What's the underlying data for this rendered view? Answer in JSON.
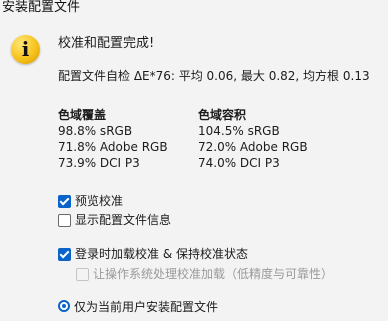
{
  "window": {
    "title": "安装配置文件"
  },
  "message": {
    "icon": "info-icon",
    "icon_glyph": "i",
    "headline": "校准和配置完成!",
    "selftest": "配置文件自检 ΔE*76: 平均 0.06, 最大 0.82, 均方根 0.13"
  },
  "coverage": {
    "heading": "色域覆盖",
    "rows": [
      "98.8% sRGB",
      "71.8% Adobe RGB",
      "73.9% DCI P3"
    ]
  },
  "volume": {
    "heading": "色域容积",
    "rows": [
      "104.5% sRGB",
      "72.0% Adobe RGB",
      "74.0% DCI P3"
    ]
  },
  "options": {
    "preview_calibration": {
      "label": "预览校准",
      "checked": true
    },
    "show_profile_info": {
      "label": "显示配置文件信息",
      "checked": false
    },
    "load_on_login": {
      "label": "登录时加载校准 & 保持校准状态",
      "checked": true
    },
    "os_load": {
      "label": "让操作系统处理校准加载（低精度与可靠性）",
      "checked": false,
      "enabled": false
    },
    "install_scope": {
      "label": "仅为当前用户安装配置文件",
      "selected": true
    }
  },
  "colors": {
    "accent": "#0a63c9",
    "background": "#f3f3f3",
    "info_icon": "#f6c21a",
    "disabled_text": "#9a9a9a"
  }
}
